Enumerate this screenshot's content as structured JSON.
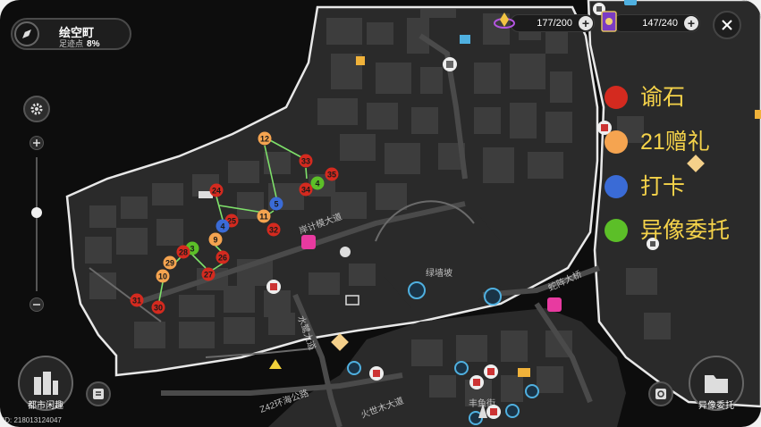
{
  "area": {
    "name": "绘空町",
    "progress_label": "足迹点",
    "progress_value": "8%"
  },
  "resources": [
    {
      "icon": "crystal-icon",
      "value": "177/200"
    },
    {
      "icon": "card-icon",
      "value": "147/240"
    }
  ],
  "legend": [
    {
      "label": "谕石",
      "color": "#d42a1f"
    },
    {
      "label": "21赠礼",
      "color": "#f5a450"
    },
    {
      "label": "打卡",
      "color": "#3a6bd6"
    },
    {
      "label": "异像委托",
      "color": "#5cbf28"
    }
  ],
  "street_labels": [
    "绿墙坡",
    "蛇阵大桥",
    "Z42环海公路",
    "火世木大道",
    "水鹭大道",
    "岸计模大道",
    "丰鱼街"
  ],
  "markers": [
    {
      "n": "12",
      "cat": "21赠礼"
    },
    {
      "n": "33",
      "cat": "谕石"
    },
    {
      "n": "35",
      "cat": "谕石"
    },
    {
      "n": "4",
      "cat": "异像委托"
    },
    {
      "n": "34",
      "cat": "谕石"
    },
    {
      "n": "5",
      "cat": "打卡"
    },
    {
      "n": "11",
      "cat": "21赠礼"
    },
    {
      "n": "32",
      "cat": "谕石"
    },
    {
      "n": "24",
      "cat": "谕石"
    },
    {
      "n": "25",
      "cat": "谕石"
    },
    {
      "n": "4",
      "cat": "打卡"
    },
    {
      "n": "9",
      "cat": "21赠礼"
    },
    {
      "n": "3",
      "cat": "异像委托"
    },
    {
      "n": "26",
      "cat": "谕石"
    },
    {
      "n": "28",
      "cat": "谕石"
    },
    {
      "n": "29",
      "cat": "21赠礼"
    },
    {
      "n": "27",
      "cat": "谕石"
    },
    {
      "n": "10",
      "cat": "21赠礼"
    },
    {
      "n": "31",
      "cat": "谕石"
    },
    {
      "n": "30",
      "cat": "谕石"
    }
  ],
  "bottom_left_button": "都市闲趣",
  "bottom_right_button": "异像委托",
  "user_id": "ID: 218013124047",
  "colors": {
    "background": "#0d0d0d",
    "land": "#2b2b2b",
    "building": "#3d3d3d",
    "road": "#4a4a4a",
    "route": "#7ee06a",
    "legend_text": "#f5d34a"
  }
}
